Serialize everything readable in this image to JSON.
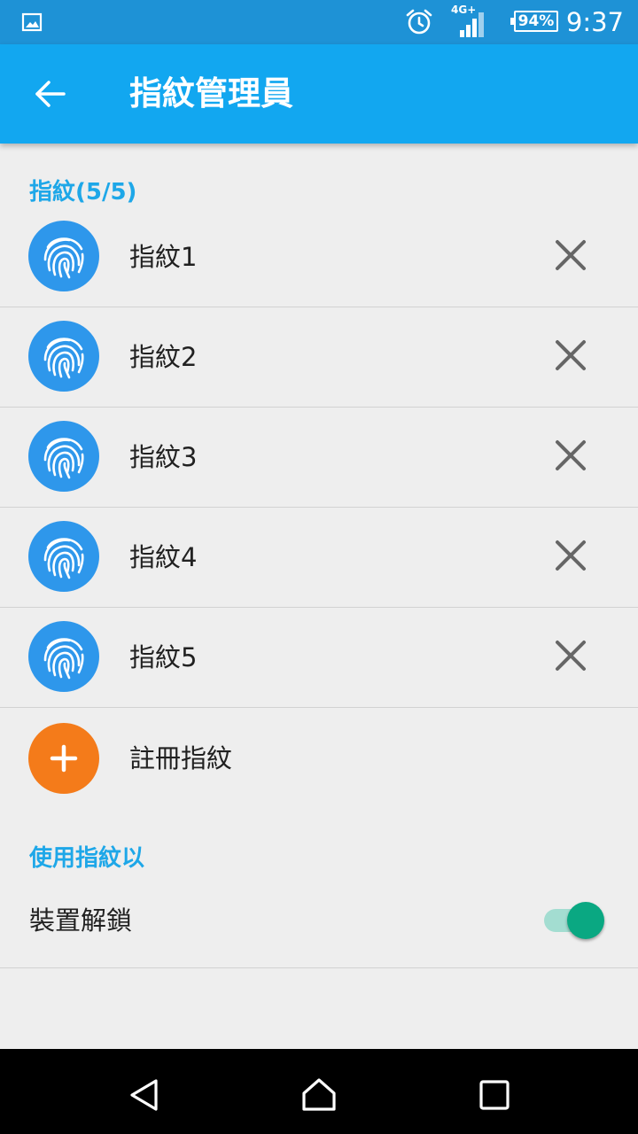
{
  "status_bar": {
    "network": "4G+",
    "battery": "94%",
    "time": "9:37",
    "icons": [
      "image-icon",
      "alarm-icon",
      "signal-icon",
      "battery-icon"
    ]
  },
  "app_bar": {
    "title": "指紋管理員",
    "back_icon": "arrow-left-icon"
  },
  "fingerprints": {
    "section_label": "指紋(5/5)",
    "items": [
      {
        "label": "指紋1"
      },
      {
        "label": "指紋2"
      },
      {
        "label": "指紋3"
      },
      {
        "label": "指紋4"
      },
      {
        "label": "指紋5"
      }
    ],
    "add_label": "註冊指紋"
  },
  "usage": {
    "section_label": "使用指紋以",
    "device_unlock_label": "裝置解鎖",
    "device_unlock_enabled": true
  },
  "colors": {
    "status_bar": "#1e92d6",
    "app_bar": "#12a7f0",
    "accent_text": "#1ea7e8",
    "fingerprint_icon_bg": "#2e97eb",
    "add_button": "#f47b1a",
    "switch_on": "#0aa882"
  }
}
